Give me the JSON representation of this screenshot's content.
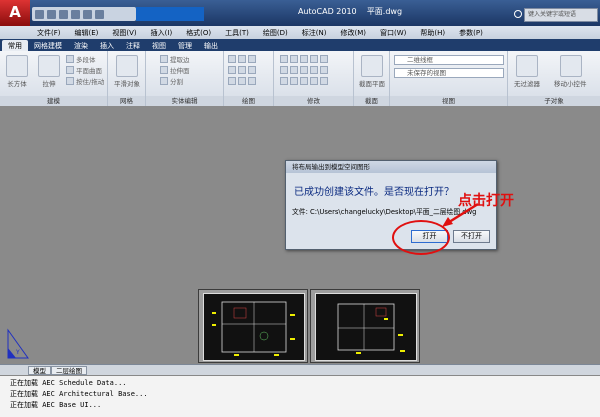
{
  "app": {
    "logo_letter": "A",
    "title": "AutoCAD 2010",
    "file_name": "平面.dwg",
    "search_placeholder": "键入关键字或短语"
  },
  "menu": [
    "文件(F)",
    "编辑(E)",
    "视图(V)",
    "插入(I)",
    "格式(O)",
    "工具(T)",
    "绘图(D)",
    "标注(N)",
    "修改(M)",
    "窗口(W)",
    "帮助(H)",
    "参数(P)"
  ],
  "tabs": [
    "常用",
    "网格建模",
    "渲染",
    "插入",
    "注释",
    "视图",
    "管理",
    "输出"
  ],
  "ribbon": {
    "modeling": {
      "label": "建模",
      "box": "长方体",
      "extrude": "拉伸",
      "smooth": "多段体",
      "plane": "平面曲面",
      "pressdrag": "按住/拖动"
    },
    "mesh": {
      "label": "网格",
      "smooth": "平滑对象"
    },
    "solid_edit": {
      "label": "实体编辑",
      "extract": "提取边",
      "extrude": "拉伸面",
      "separate": "分割"
    },
    "draw": {
      "label": "绘图"
    },
    "modify": {
      "label": "修改"
    },
    "section": {
      "plane": "截面平面",
      "label": "截面"
    },
    "view": {
      "label": "视图",
      "visual_style": "二维线框",
      "saved_view": "未保存的视图"
    },
    "subobject": {
      "label": "子对象",
      "filter": "无过滤器",
      "gizmo": "移动小控件"
    }
  },
  "dialog": {
    "title": "将布局输出到模型空间图形",
    "message": "已成功创建该文件。是否现在打开？",
    "file_label": "文件: C:\\Users\\changelucky\\Desktop\\平面_二层绘图.dwg",
    "open_button": "打开",
    "no_open_button": "不打开"
  },
  "annotation": "点击打开",
  "layout_tabs": [
    "模型",
    "二层绘图"
  ],
  "command_lines": [
    "正在加载 AEC Schedule Data...",
    "正在加载 AEC Architectural Base...",
    "正在加载 AEC Base UI..."
  ],
  "colors": {
    "accent_red": "#e01010",
    "title_blue": "#1f3d6c"
  }
}
